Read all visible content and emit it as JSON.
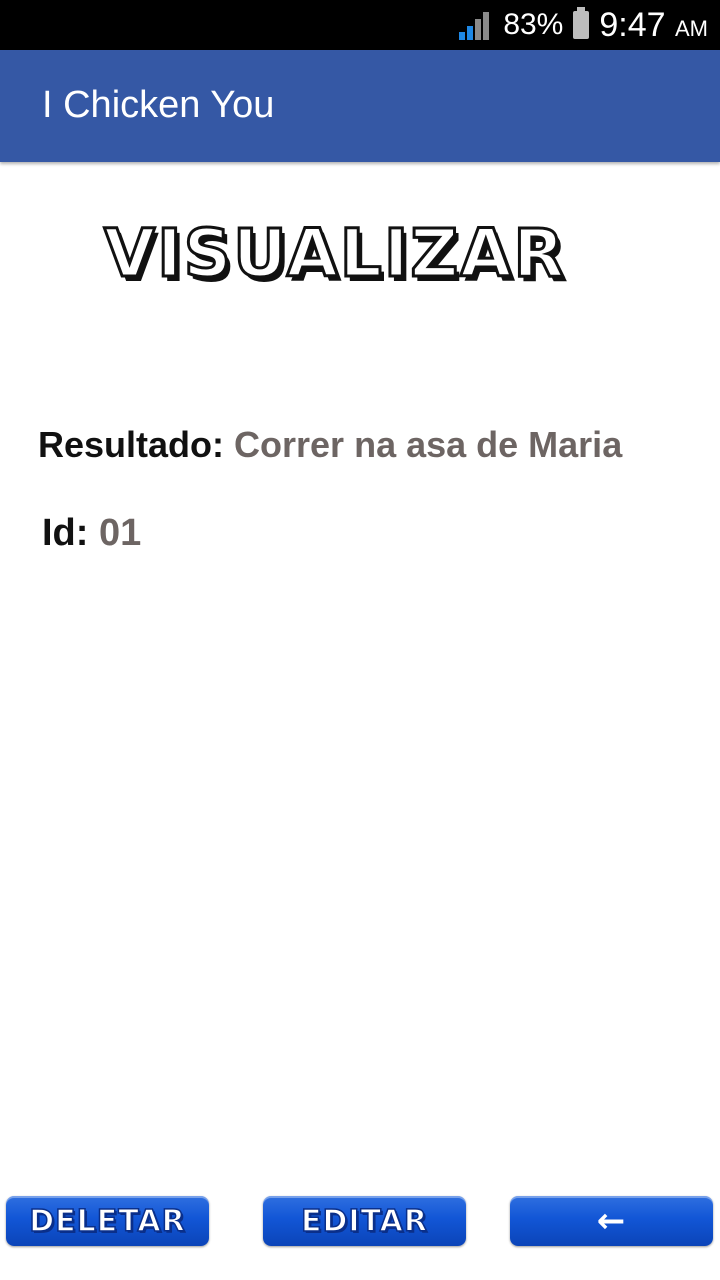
{
  "status_bar": {
    "battery_percent": "83%",
    "time": "9:47",
    "am_pm": "AM"
  },
  "app_bar": {
    "title": "I Chicken You"
  },
  "screen": {
    "title": "VISUALIZAR",
    "result_label": "Resultado:",
    "result_value": "Correr na asa de Maria",
    "id_label": "Id:",
    "id_value": "01"
  },
  "buttons": {
    "delete_label": "DELETAR",
    "edit_label": "EDITAR",
    "back_label": "←"
  },
  "colors": {
    "app_bar": "#3558a5",
    "button": "#1256d6",
    "value_text": "#6d6563"
  }
}
